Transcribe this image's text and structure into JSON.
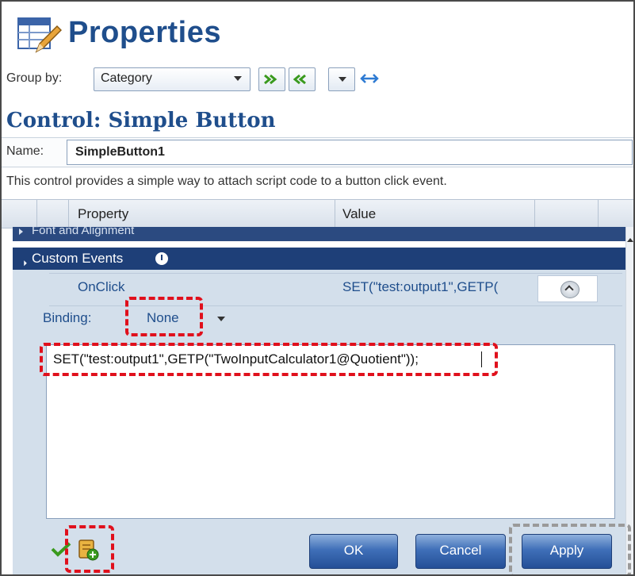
{
  "header": {
    "title": "Properties",
    "icon": "properties-table-pencil-icon"
  },
  "toolbar": {
    "group_by_label": "Group by:",
    "group_by_value": "Category",
    "buttons": [
      "expand-all-icon",
      "collapse-all-icon",
      "dropdown-arrow",
      "resize-width-icon"
    ]
  },
  "control": {
    "section_title": "Control: Simple Button",
    "name_label": "Name:",
    "name_value": "SimpleButton1",
    "description": "This control provides a simple way to attach script code to a button click event."
  },
  "grid": {
    "columns": [
      "Property",
      "Value"
    ],
    "categories": [
      {
        "label": "Font and Alignment",
        "expanded": false
      },
      {
        "label": "Custom Events",
        "expanded": true
      }
    ],
    "event_row": {
      "name": "OnClick",
      "value": "SET(\"test:output1\",GETP("
    }
  },
  "editor": {
    "binding_label": "Binding:",
    "binding_value": "None",
    "code": "SET(\"test:output1\",GETP(\"TwoInputCalculator1@Quotient\"));"
  },
  "footer": {
    "ok": "OK",
    "cancel": "Cancel",
    "apply": "Apply"
  },
  "colors": {
    "accent": "#1f4e8c",
    "category_header": "#1e3f78",
    "highlight_red": "#e0101c",
    "highlight_gray": "#9a9a9a"
  }
}
